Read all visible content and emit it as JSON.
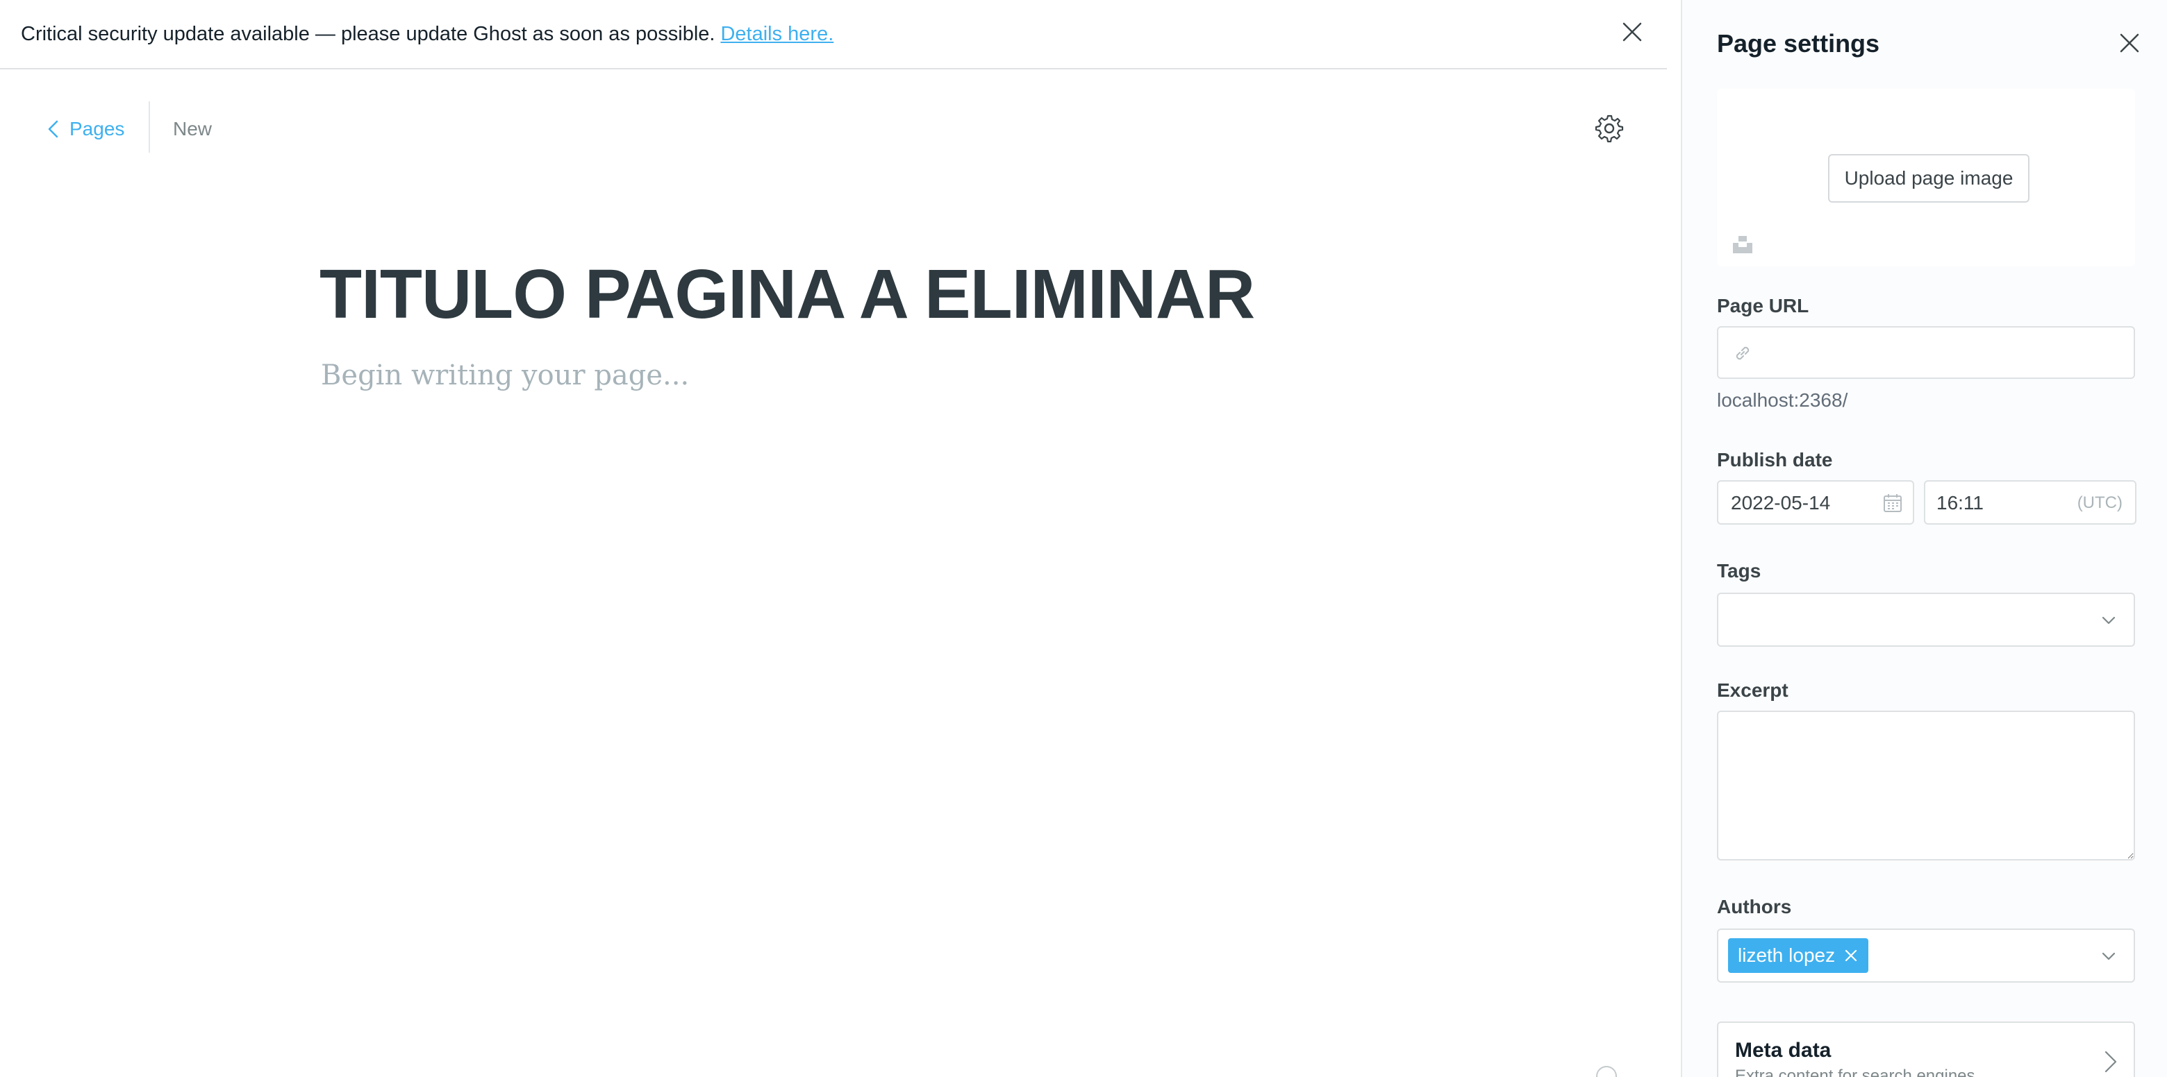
{
  "alert": {
    "message": "Critical security update available — please update Ghost as soon as possible.",
    "link_text": "Details here.",
    "close_icon": "close-icon"
  },
  "nav": {
    "back_label": "Pages",
    "status": "New",
    "settings_icon": "gear-icon"
  },
  "editor": {
    "title": "TITULO PAGINA A ELIMINAR",
    "body_placeholder": "Begin writing your page..."
  },
  "panel": {
    "title": "Page settings",
    "upload_label": "Upload page image",
    "page_url": {
      "label": "Page URL",
      "value": "",
      "hint": "localhost:2368/"
    },
    "publish_date": {
      "label": "Publish date",
      "date": "2022-05-14",
      "time": "16:11",
      "timezone": "(UTC)"
    },
    "tags": {
      "label": "Tags",
      "selected": []
    },
    "excerpt": {
      "label": "Excerpt",
      "value": ""
    },
    "authors": {
      "label": "Authors",
      "selected": [
        "lizeth lopez"
      ]
    },
    "meta_data": {
      "title": "Meta data",
      "subtitle": "Extra content for search engines"
    }
  },
  "colors": {
    "accent": "#3eb0ef",
    "text": "#15212a",
    "muted": "#7d878a",
    "border": "#dde1e3"
  }
}
